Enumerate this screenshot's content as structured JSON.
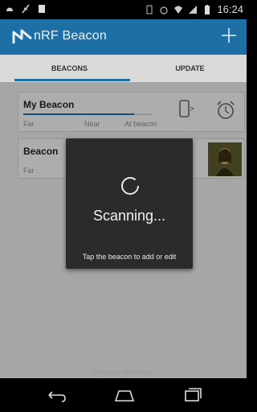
{
  "status_bar": {
    "time": "16:24",
    "left_icons": [
      "notification-icon",
      "usb-icon",
      "sd-card-icon"
    ],
    "right_icons": [
      "vibrate-icon",
      "alarm-icon",
      "wifi-icon",
      "signal-icon",
      "battery-icon"
    ]
  },
  "app_bar": {
    "title": "nRF Beacon",
    "logo_icon": "nordic-logo-icon",
    "add_icon": "plus-icon"
  },
  "tabs": [
    {
      "label": "BEACONS",
      "selected": true
    },
    {
      "label": "UPDATE",
      "selected": false
    }
  ],
  "beacons": [
    {
      "name": "My Beacon",
      "signal_fraction": 0.86,
      "labels": {
        "far": "Far",
        "near": "Near",
        "at": "At beacon"
      },
      "icons": [
        "phone-unlock-icon",
        "alarm-clock-icon"
      ]
    },
    {
      "name": "Beacon",
      "labels": {
        "far": "Far"
      },
      "icons": [
        "portrait-image-icon"
      ]
    }
  ],
  "dialog": {
    "title": "Scanning...",
    "hint": "Tap the beacon to add or edit",
    "spinner_icon": "progress-spinner-icon"
  },
  "footer": {
    "text": "Wireless by Nordic"
  },
  "nav_bar": {
    "icons": [
      "back-icon",
      "home-icon",
      "recent-apps-icon"
    ]
  },
  "colors": {
    "accent": "#1d6fa6",
    "background": "#e6e6e6",
    "dialog": "#2b2b2b"
  }
}
